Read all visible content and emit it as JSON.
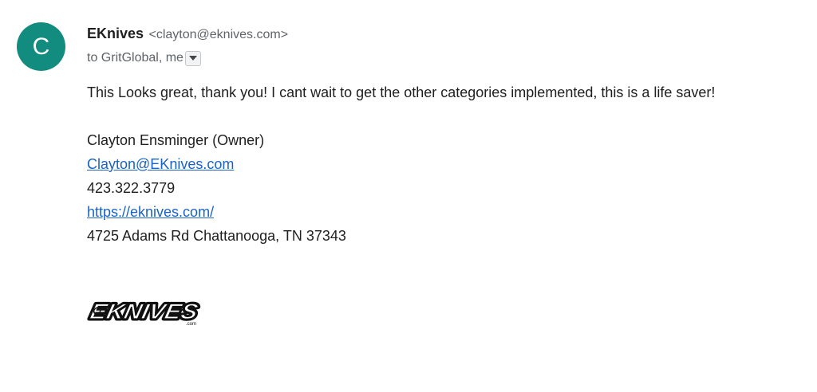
{
  "sender": {
    "avatar_initial": "C",
    "avatar_color": "#128c7e",
    "name": "EKnives",
    "email": "<clayton@eknives.com>"
  },
  "recipients": {
    "text": "to GritGlobal, me",
    "toggle_icon": "caret-down"
  },
  "message": {
    "text": "This Looks great, thank you! I cant wait to get the other categories implemented, this is a life saver!"
  },
  "signature": {
    "name": "Clayton Ensminger (Owner)",
    "email": "Clayton@EKnives.com",
    "phone": "423.322.3779",
    "website": "https://eknives.com/",
    "address": "4725 Adams Rd Chattanooga, TN 37343",
    "logo_text": "EKNIVES",
    "logo_subtext": ".com"
  },
  "colors": {
    "link": "#1a63c6",
    "text": "#1f1f1f",
    "muted": "#5f6368"
  }
}
